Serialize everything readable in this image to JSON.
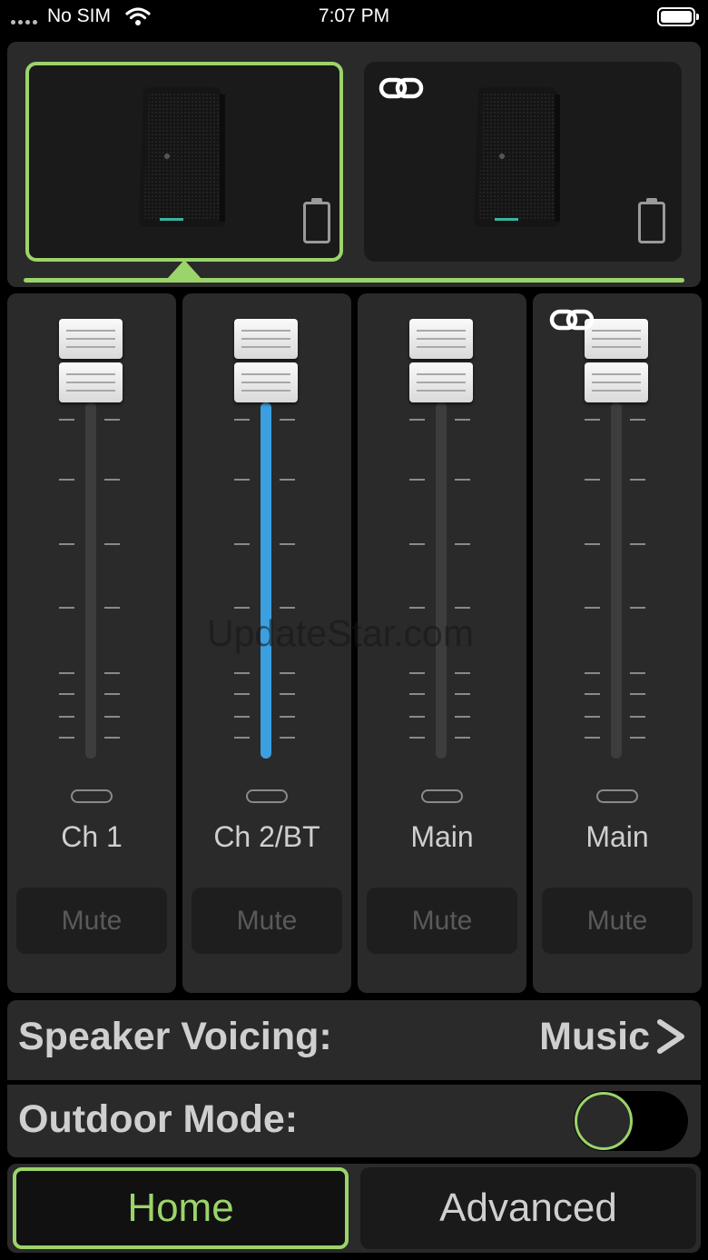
{
  "status_bar": {
    "carrier": "No SIM",
    "time": "7:07 PM"
  },
  "speakers": [
    {
      "selected": true,
      "linked": false,
      "battery_icon": "battery-icon"
    },
    {
      "selected": false,
      "linked": true,
      "battery_icon": "battery-icon"
    }
  ],
  "channels": [
    {
      "name": "Ch 1",
      "mute_label": "Mute",
      "level": 1.0,
      "fill_color": "#3d3d3d"
    },
    {
      "name": "Ch 2/BT",
      "mute_label": "Mute",
      "level": 1.0,
      "fill_color": "#3b9fe0"
    },
    {
      "name": "Main",
      "mute_label": "Mute",
      "level": 1.0,
      "fill_color": "#3d3d3d"
    },
    {
      "name": "Main",
      "mute_label": "Mute",
      "level": 1.0,
      "fill_color": "#3d3d3d",
      "linked": true
    }
  ],
  "watermark": "UpdateStar.com",
  "settings": {
    "speaker_voicing": {
      "label": "Speaker Voicing:",
      "value": "Music"
    },
    "outdoor_mode": {
      "label": "Outdoor Mode:",
      "enabled": false
    }
  },
  "tabs": [
    {
      "label": "Home",
      "active": true
    },
    {
      "label": "Advanced",
      "active": false
    }
  ],
  "colors": {
    "accent": "#9bd46a",
    "panel": "#2a2a2a",
    "fader_blue": "#3b9fe0"
  }
}
